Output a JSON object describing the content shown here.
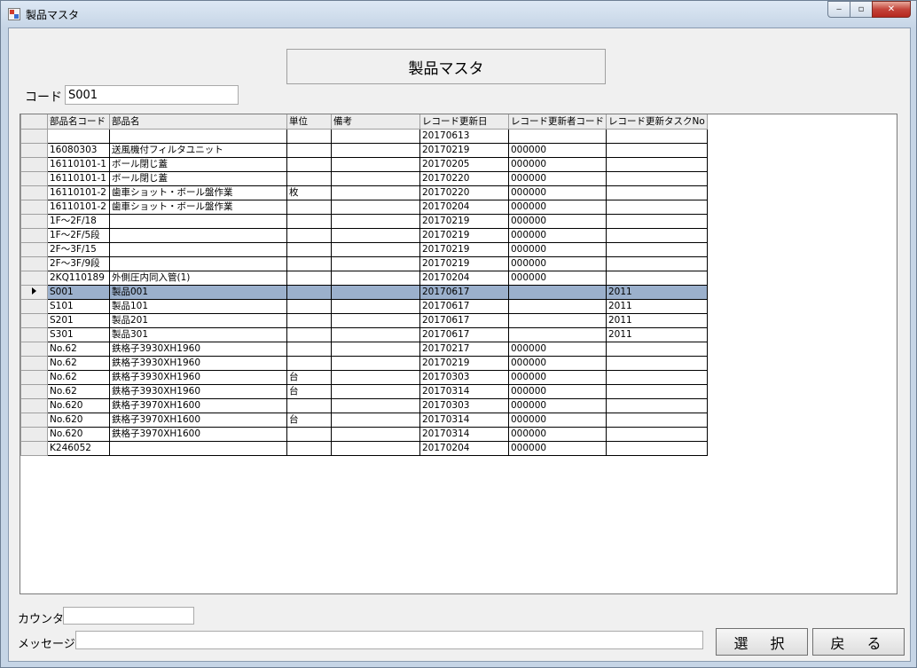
{
  "window": {
    "title": "製品マスタ",
    "controls": {
      "minimize": "‒",
      "maximize": "▫",
      "close": "✕"
    }
  },
  "form": {
    "header": "製品マスタ",
    "code_label": "コード",
    "code_value": "S001",
    "count_label": "カウンタ",
    "count_value": "",
    "message_label": "メッセージ",
    "message_value": "",
    "select_button": "選 択",
    "back_button": "戻 る"
  },
  "grid": {
    "columns": [
      "部品名コード",
      "部品名",
      "単位",
      "備考",
      "レコード更新日",
      "レコード更新者コード",
      "レコード更新タスクNo"
    ],
    "selected_row": 11,
    "rows": [
      [
        "",
        "",
        "",
        "",
        "20170613",
        "",
        ""
      ],
      [
        "16080303",
        "送風機付フィルタユニット",
        "",
        "",
        "20170219",
        "000000",
        ""
      ],
      [
        "16110101-1",
        "ボール閉じ蓋",
        "",
        "",
        "20170205",
        "000000",
        ""
      ],
      [
        "16110101-1",
        "ボール閉じ蓋",
        "",
        "",
        "20170220",
        "000000",
        ""
      ],
      [
        "16110101-2",
        "歯車ショット・ボール盤作業",
        "枚",
        "",
        "20170220",
        "000000",
        ""
      ],
      [
        "16110101-2",
        "歯車ショット・ボール盤作業",
        "",
        "",
        "20170204",
        "000000",
        ""
      ],
      [
        "1F～2F/18",
        "",
        "",
        "",
        "20170219",
        "000000",
        ""
      ],
      [
        "1F～2F/5段",
        "",
        "",
        "",
        "20170219",
        "000000",
        ""
      ],
      [
        "2F～3F/15",
        "",
        "",
        "",
        "20170219",
        "000000",
        ""
      ],
      [
        "2F～3F/9段",
        "",
        "",
        "",
        "20170219",
        "000000",
        ""
      ],
      [
        "2KQ110189",
        "外側圧内同入管(1)",
        "",
        "",
        "20170204",
        "000000",
        ""
      ],
      [
        "S001",
        "製品001",
        "",
        "",
        "20170617",
        "",
        "2011"
      ],
      [
        "S101",
        "製品101",
        "",
        "",
        "20170617",
        "",
        "2011"
      ],
      [
        "S201",
        "製品201",
        "",
        "",
        "20170617",
        "",
        "2011"
      ],
      [
        "S301",
        "製品301",
        "",
        "",
        "20170617",
        "",
        "2011"
      ],
      [
        "No.62",
        "鉄格子3930XH1960",
        "",
        "",
        "20170217",
        "000000",
        ""
      ],
      [
        "No.62",
        "鉄格子3930XH1960",
        "",
        "",
        "20170219",
        "000000",
        ""
      ],
      [
        "No.62",
        "鉄格子3930XH1960",
        "台",
        "",
        "20170303",
        "000000",
        ""
      ],
      [
        "No.62",
        "鉄格子3930XH1960",
        "台",
        "",
        "20170314",
        "000000",
        ""
      ],
      [
        "No.620",
        "鉄格子3970XH1600",
        "",
        "",
        "20170303",
        "000000",
        ""
      ],
      [
        "No.620",
        "鉄格子3970XH1600",
        "台",
        "",
        "20170314",
        "000000",
        ""
      ],
      [
        "No.620",
        "鉄格子3970XH1600",
        "",
        "",
        "20170314",
        "000000",
        ""
      ],
      [
        "K246052",
        "",
        "",
        "",
        "20170204",
        "000000",
        ""
      ]
    ]
  }
}
